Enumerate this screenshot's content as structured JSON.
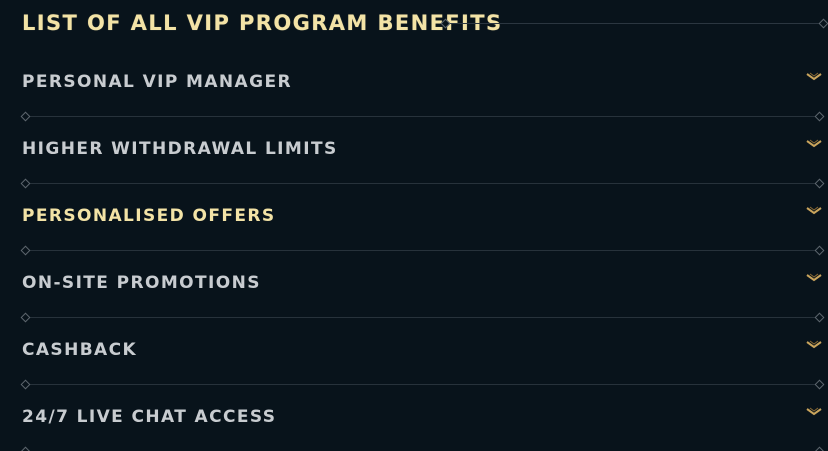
{
  "header": {
    "title": "List of all VIP program benefits"
  },
  "benefits": [
    {
      "label": "Personal VIP manager",
      "highlighted": false
    },
    {
      "label": "Higher withdrawal limits",
      "highlighted": false
    },
    {
      "label": "Personalised offers",
      "highlighted": true
    },
    {
      "label": "On-site promotions",
      "highlighted": false
    },
    {
      "label": "Cashback",
      "highlighted": false
    },
    {
      "label": "24/7 live chat access",
      "highlighted": false
    }
  ],
  "icons": {
    "expand": "chevron-down-icon",
    "divider_end": "diamond-icon"
  },
  "colors": {
    "background": "#08131b",
    "title_gold": "#f3e3a6",
    "label_grey": "#c8ccd0",
    "chevron_gold": "#c9a45c",
    "divider": "#27323b"
  }
}
